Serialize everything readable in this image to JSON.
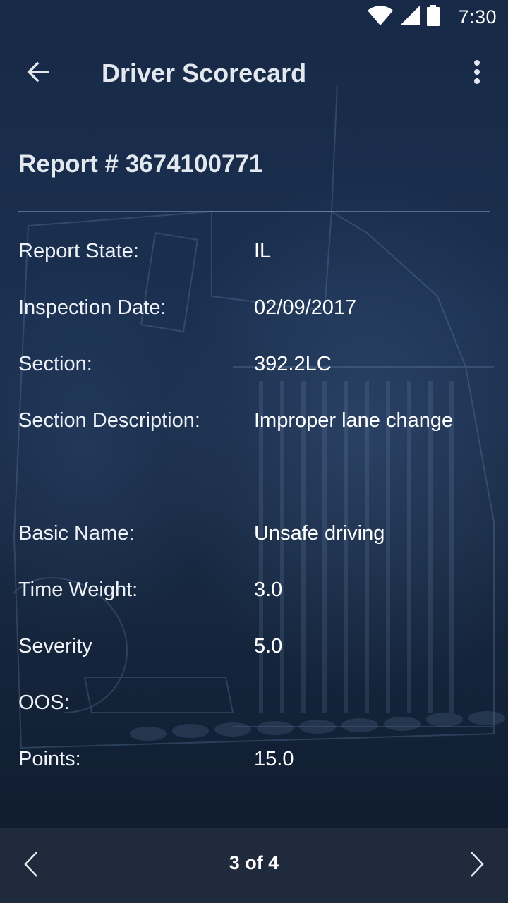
{
  "status_bar": {
    "time": "7:30",
    "icons": [
      "wifi-icon",
      "signal-icon",
      "battery-icon"
    ]
  },
  "app_bar": {
    "title": "Driver Scorecard",
    "back_icon": "arrow-back-icon",
    "menu_icon": "more-vert-icon"
  },
  "report": {
    "header": "Report # 3674100771",
    "fields": [
      {
        "label": "Report State:",
        "value": "IL"
      },
      {
        "label": "Inspection Date:",
        "value": "02/09/2017"
      },
      {
        "label": "Section:",
        "value": "392.2LC"
      },
      {
        "label": "Section Description:",
        "value": "Improper lane change"
      },
      {
        "label": "Basic Name:",
        "value": "Unsafe driving"
      },
      {
        "label": "Time Weight:",
        "value": "3.0"
      },
      {
        "label": "Severity",
        "value": "5.0"
      },
      {
        "label": "OOS:",
        "value": ""
      },
      {
        "label": "Points:",
        "value": "15.0"
      }
    ]
  },
  "pager": {
    "label": "3 of 4",
    "prev_icon": "chevron-left-icon",
    "next_icon": "chevron-right-icon"
  },
  "colors": {
    "background": "#152540",
    "pager_bar": "#212b3e",
    "text": "#e6ebf2"
  }
}
